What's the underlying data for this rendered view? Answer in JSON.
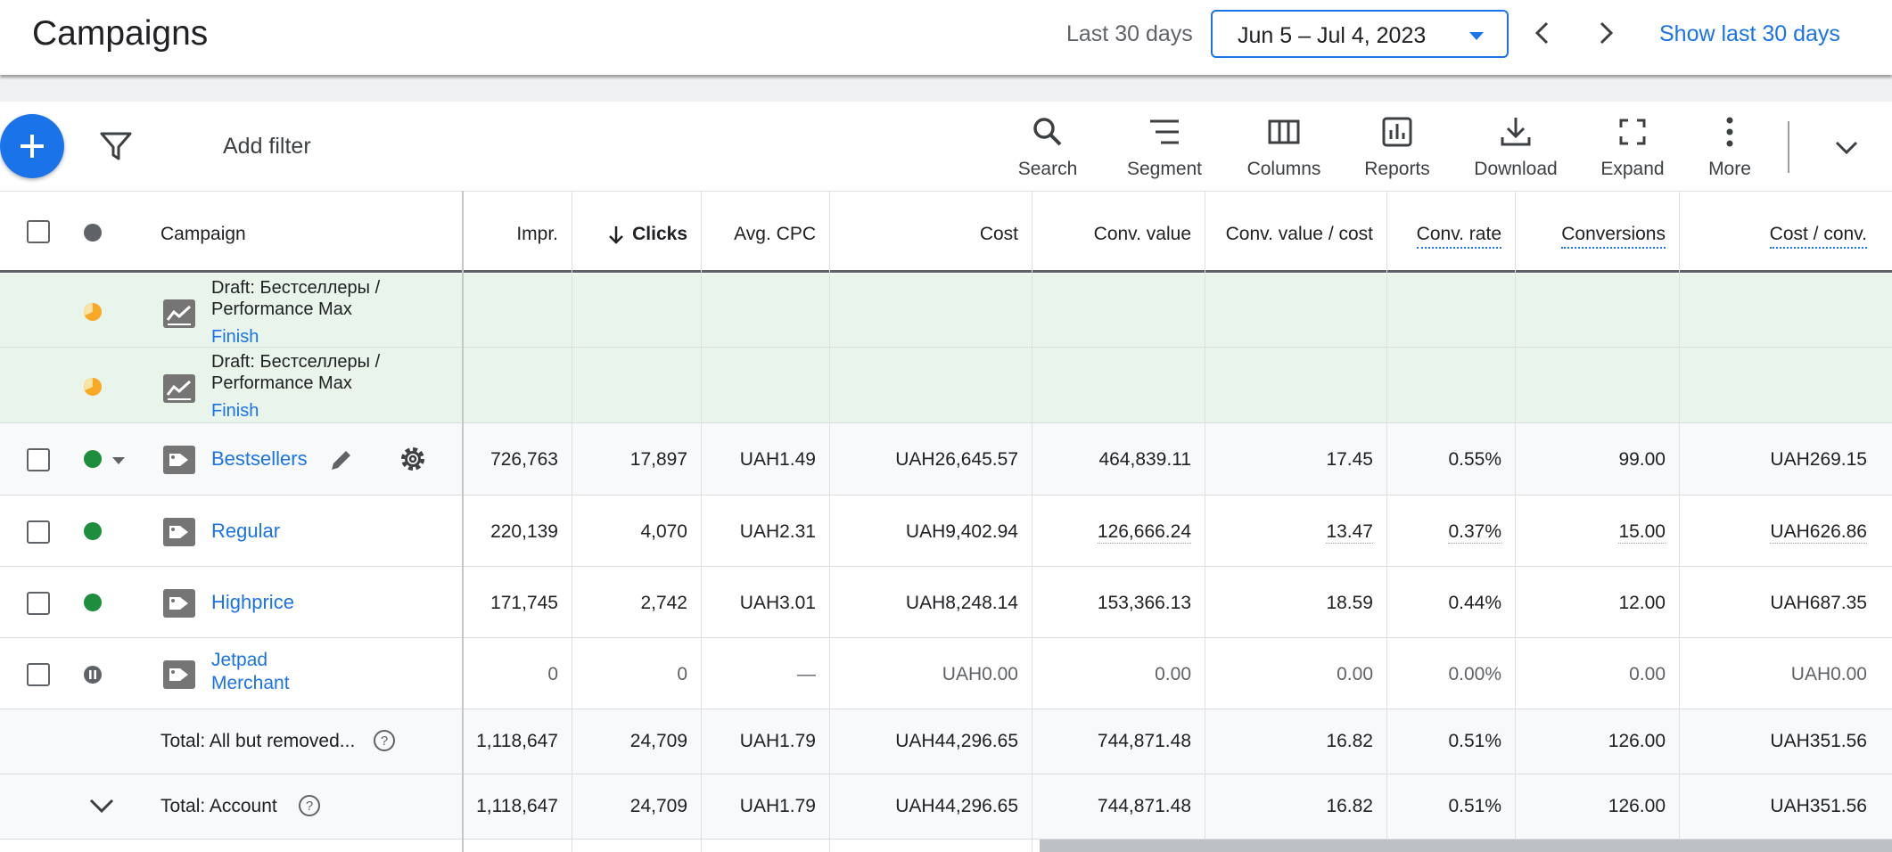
{
  "header": {
    "title": "Campaigns",
    "range_label": "Last 30 days",
    "date_range": "Jun 5 – Jul 4, 2023",
    "show_last_label": "Show last 30 days"
  },
  "toolbar": {
    "add_filter": "Add filter",
    "tools": [
      {
        "label": "Search",
        "icon": "search-icon"
      },
      {
        "label": "Segment",
        "icon": "segment-icon"
      },
      {
        "label": "Columns",
        "icon": "columns-icon"
      },
      {
        "label": "Reports",
        "icon": "reports-icon"
      },
      {
        "label": "Download",
        "icon": "download-icon"
      },
      {
        "label": "Expand",
        "icon": "expand-icon"
      },
      {
        "label": "More",
        "icon": "more-vert-icon"
      }
    ]
  },
  "table": {
    "columns": {
      "campaign": "Campaign",
      "impr": "Impr.",
      "clicks": "Clicks",
      "avg_cpc": "Avg. CPC",
      "cost": "Cost",
      "conv_value": "Conv. value",
      "conv_value_cost": "Conv. value / cost",
      "conv_rate": "Conv. rate",
      "conversions": "Conversions",
      "cost_conv": "Cost / conv."
    },
    "drafts": [
      {
        "line1": "Draft: Бестселлеры /",
        "line2": "Performance Max",
        "action": "Finish"
      },
      {
        "line1": "Draft: Бестселлеры /",
        "line2": "Performance Max",
        "action": "Finish"
      }
    ],
    "rows": [
      {
        "name": "Bestsellers",
        "status": "enabled",
        "impr": "726,763",
        "clicks": "17,897",
        "avg_cpc": "UAH1.49",
        "cost": "UAH26,645.57",
        "conv_value": "464,839.11",
        "conv_value_cost": "17.45",
        "conv_rate": "0.55%",
        "conversions": "99.00",
        "cost_conv": "UAH269.15"
      },
      {
        "name": "Regular",
        "status": "enabled",
        "impr": "220,139",
        "clicks": "4,070",
        "avg_cpc": "UAH2.31",
        "cost": "UAH9,402.94",
        "conv_value": "126,666.24",
        "conv_value_cost": "13.47",
        "conv_rate": "0.37%",
        "conversions": "15.00",
        "cost_conv": "UAH626.86"
      },
      {
        "name": "Highprice",
        "status": "enabled",
        "impr": "171,745",
        "clicks": "2,742",
        "avg_cpc": "UAH3.01",
        "cost": "UAH8,248.14",
        "conv_value": "153,366.13",
        "conv_value_cost": "18.59",
        "conv_rate": "0.44%",
        "conversions": "12.00",
        "cost_conv": "UAH687.35"
      },
      {
        "name_line1": "Jetpad",
        "name_line2": "Merchant",
        "status": "paused",
        "impr": "0",
        "clicks": "0",
        "avg_cpc": "—",
        "cost": "UAH0.00",
        "conv_value": "0.00",
        "conv_value_cost": "0.00",
        "conv_rate": "0.00%",
        "conversions": "0.00",
        "cost_conv": "UAH0.00"
      }
    ],
    "totals": [
      {
        "label": "Total: All but removed...",
        "impr": "1,118,647",
        "clicks": "24,709",
        "avg_cpc": "UAH1.79",
        "cost": "UAH44,296.65",
        "conv_value": "744,871.48",
        "conv_value_cost": "16.82",
        "conv_rate": "0.51%",
        "conversions": "126.00",
        "cost_conv": "UAH351.56"
      },
      {
        "label": "Total: Account",
        "impr": "1,118,647",
        "clicks": "24,709",
        "avg_cpc": "UAH1.79",
        "cost": "UAH44,296.65",
        "conv_value": "744,871.48",
        "conv_value_cost": "16.82",
        "conv_rate": "0.51%",
        "conversions": "126.00",
        "cost_conv": "UAH351.56"
      }
    ]
  },
  "colors": {
    "accent": "#1a73e8",
    "enabled": "#1e8e3e",
    "paused": "#5f6368",
    "draft_bg": "#e9f4ea",
    "draft_icon": "#f9a825"
  }
}
